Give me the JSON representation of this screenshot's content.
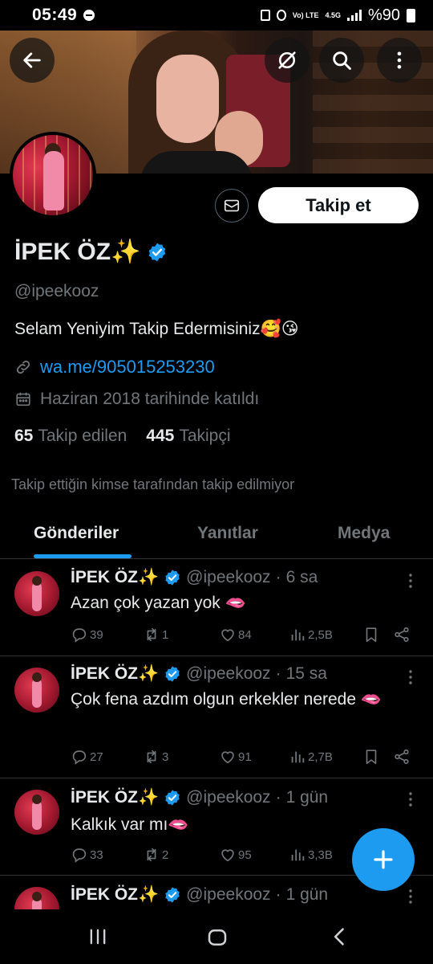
{
  "status_bar": {
    "time": "05:49",
    "battery": "%90",
    "network": "4.5G",
    "volte": "Vo) LTE"
  },
  "header": {
    "back_icon": "arrow-left-icon",
    "grok_icon": "grok-icon",
    "search_icon": "search-icon",
    "more_icon": "more-vertical-icon"
  },
  "profile": {
    "display_name": "İPEK ÖZ✨",
    "handle": "@ipeekooz",
    "bio": "Selam Yeniyim Takip Edermisiniz🥰😘",
    "link": "wa.me/905015253230",
    "joined": "Haziran 2018 tarihinde katıldı",
    "following_count": "65",
    "following_label": "Takip edilen",
    "followers_count": "445",
    "followers_label": "Takipçi",
    "not_followed_note": "Takip ettiğin kimse tarafından takip edilmiyor",
    "follow_button": "Takip et"
  },
  "tabs": [
    {
      "label": "Gönderiler",
      "active": true
    },
    {
      "label": "Yanıtlar",
      "active": false
    },
    {
      "label": "Medya",
      "active": false
    }
  ],
  "posts": [
    {
      "name": "İPEK ÖZ✨",
      "handle": "@ipeekooz",
      "dot": "·",
      "time": "6 sa",
      "text": "Azan çok yazan yok 🫦",
      "replies": "39",
      "reposts": "1",
      "likes": "84",
      "views": "2,5B"
    },
    {
      "name": "İPEK ÖZ✨",
      "handle": "@ipeekooz",
      "dot": "·",
      "time": "15 sa",
      "text": "Çok fena azdım olgun erkekler nerede 🫦",
      "replies": "27",
      "reposts": "3",
      "likes": "91",
      "views": "2,7B"
    },
    {
      "name": "İPEK ÖZ✨",
      "handle": "@ipeekooz",
      "dot": "·",
      "time": "1 gün",
      "text": "Kalkık var mı🫦",
      "replies": "33",
      "reposts": "2",
      "likes": "95",
      "views": "3,3B"
    },
    {
      "name": "İPEK ÖZ✨",
      "handle": "@ipeekooz",
      "dot": "·",
      "time": "1 gün",
      "text": "",
      "replies": "",
      "reposts": "",
      "likes": "",
      "views": ""
    }
  ],
  "colors": {
    "accent": "#1d9bf0",
    "background": "#000000",
    "text_primary": "#e7e9ea",
    "text_secondary": "#71767b",
    "divider": "#2f3336"
  }
}
